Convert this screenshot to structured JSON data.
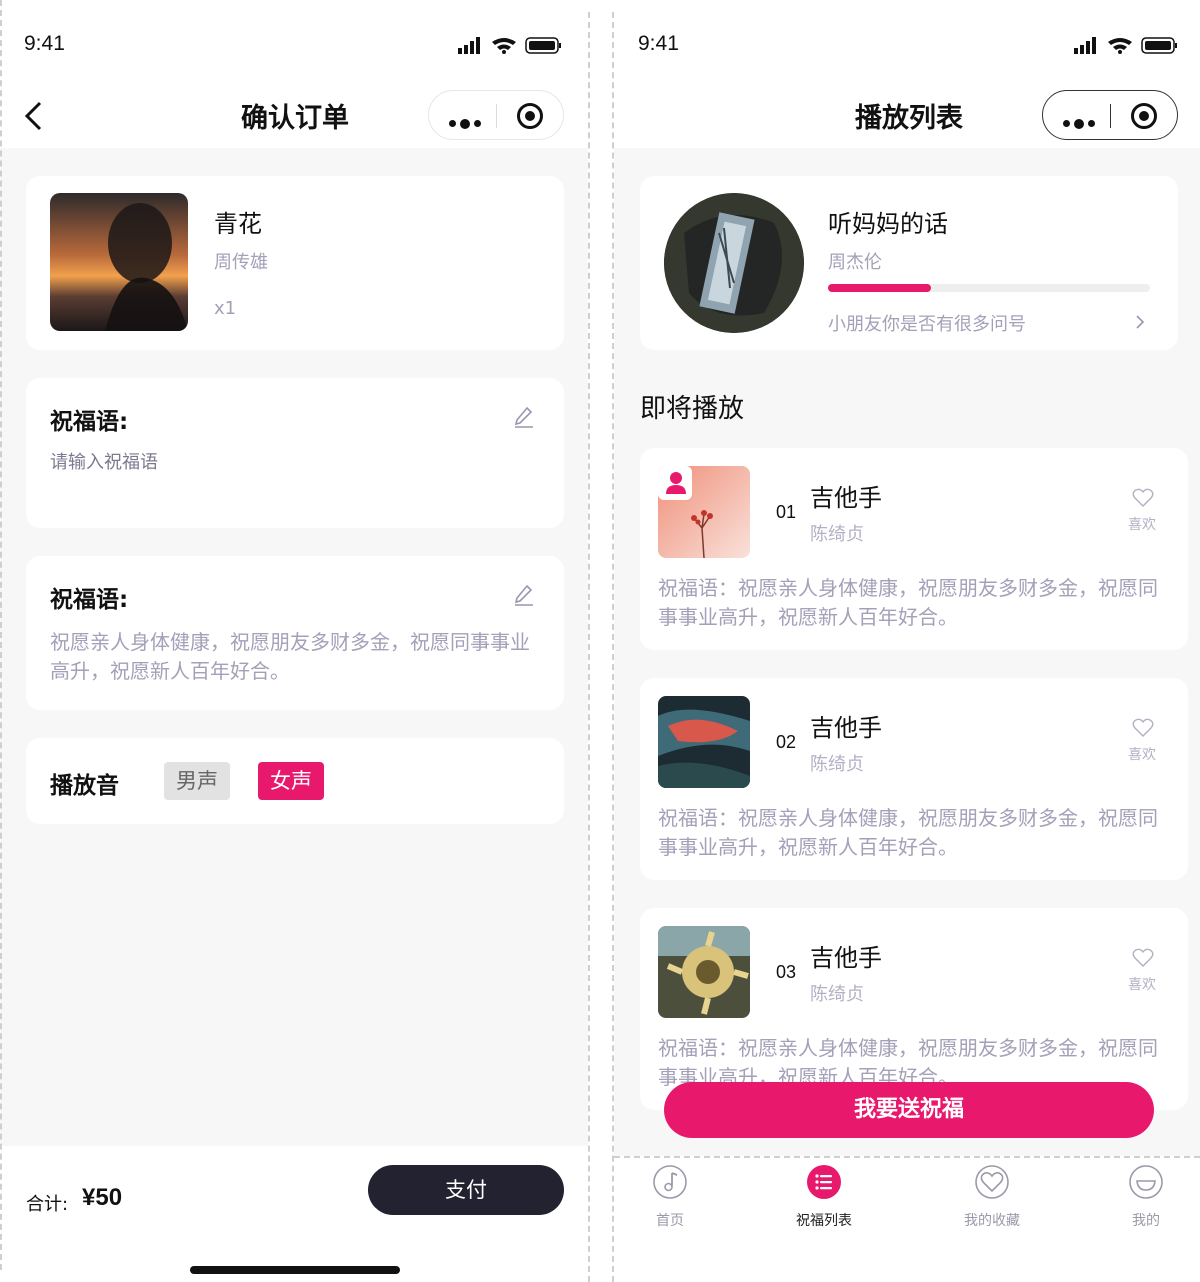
{
  "left": {
    "status_time": "9:41",
    "nav_title": "确认订单",
    "product": {
      "title": "青花",
      "artist": "周传雄",
      "qty": "x1"
    },
    "blessing_empty": {
      "label": "祝福语:",
      "placeholder": "请输入祝福语"
    },
    "blessing_filled": {
      "label": "祝福语:",
      "text": "祝愿亲人身体健康，祝愿朋友多财多金，祝愿同事事业高升，祝愿新人百年好合。"
    },
    "voice": {
      "label": "播放音",
      "options": [
        "男声",
        "女声"
      ],
      "selected": "女声"
    },
    "footer": {
      "total_label": "合计:",
      "total_value": "¥50",
      "pay_label": "支付"
    }
  },
  "right": {
    "status_time": "9:41",
    "nav_title": "播放列表",
    "now_playing": {
      "title": "听妈妈的话",
      "artist": "周杰伦",
      "lyric": "小朋友你是否有很多问号",
      "progress": 0.32
    },
    "upcoming_title": "即将播放",
    "songs": [
      {
        "index": "01",
        "title": "吉他手",
        "artist": "陈绮贞",
        "like": "喜欢",
        "message": "祝福语：祝愿亲人身体健康，祝愿朋友多财多金，祝愿同事事业高升，祝愿新人百年好合。"
      },
      {
        "index": "02",
        "title": "吉他手",
        "artist": "陈绮贞",
        "like": "喜欢",
        "message": "祝福语：祝愿亲人身体健康，祝愿朋友多财多金，祝愿同事事业高升，祝愿新人百年好合。"
      },
      {
        "index": "03",
        "title": "吉他手",
        "artist": "陈绮贞",
        "like": "喜欢",
        "message": "祝福语：祝愿亲人身体健康，祝愿朋友多财多金，祝愿同事事业高升，祝愿新人百年好合。"
      }
    ],
    "send_button": "我要送祝福",
    "tabs": [
      {
        "label": "首页",
        "icon": "music-note-icon"
      },
      {
        "label": "祝福列表",
        "icon": "list-icon"
      },
      {
        "label": "我的收藏",
        "icon": "heart-icon"
      },
      {
        "label": "我的",
        "icon": "smile-icon"
      }
    ],
    "active_tab": "祝福列表"
  },
  "colors": {
    "accent": "#e8196c",
    "dark_button": "#222230",
    "muted_text": "#a4a0b8"
  }
}
